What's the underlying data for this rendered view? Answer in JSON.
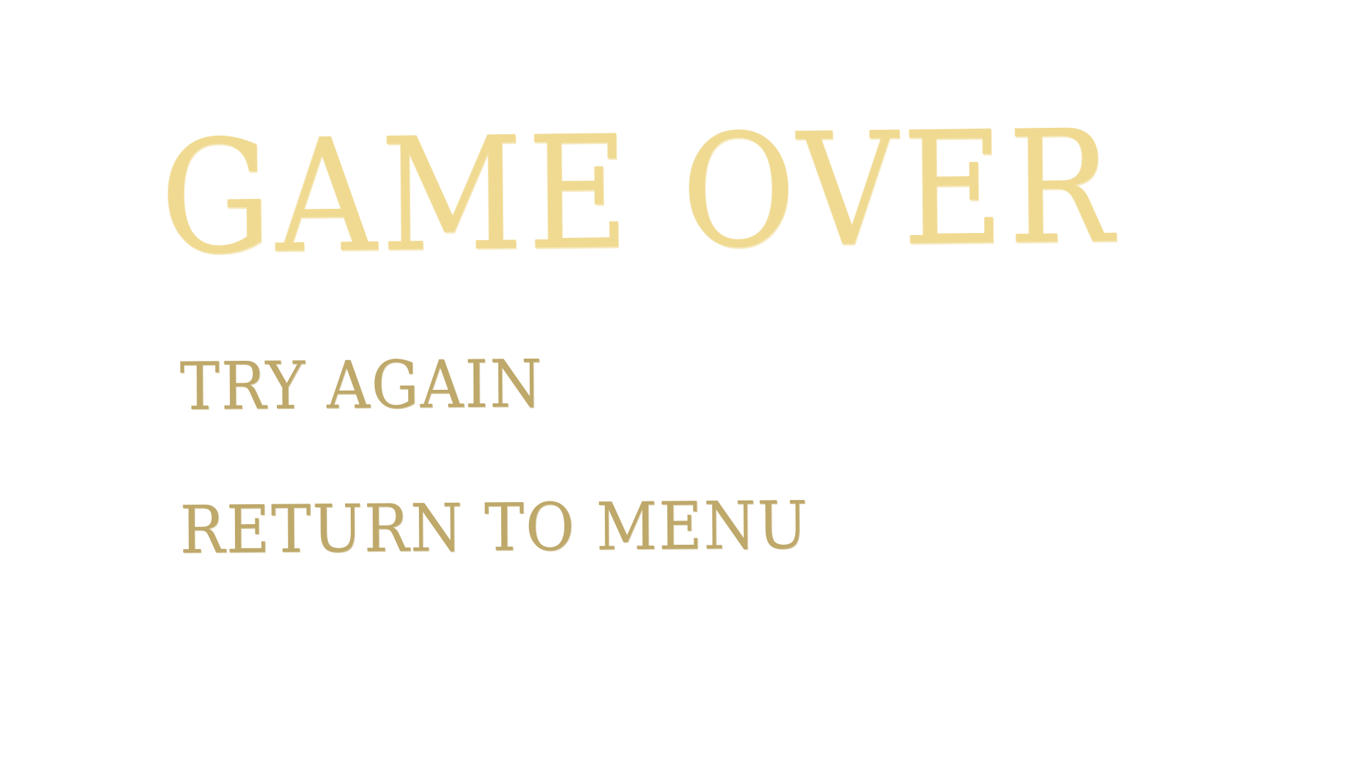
{
  "screen": {
    "title": "GAME OVER",
    "title_color": "#F0DA92",
    "menu": {
      "color": "#BEA86A",
      "items": [
        {
          "label": "TRY AGAIN"
        },
        {
          "label": "RETURN TO MENU"
        }
      ]
    }
  }
}
